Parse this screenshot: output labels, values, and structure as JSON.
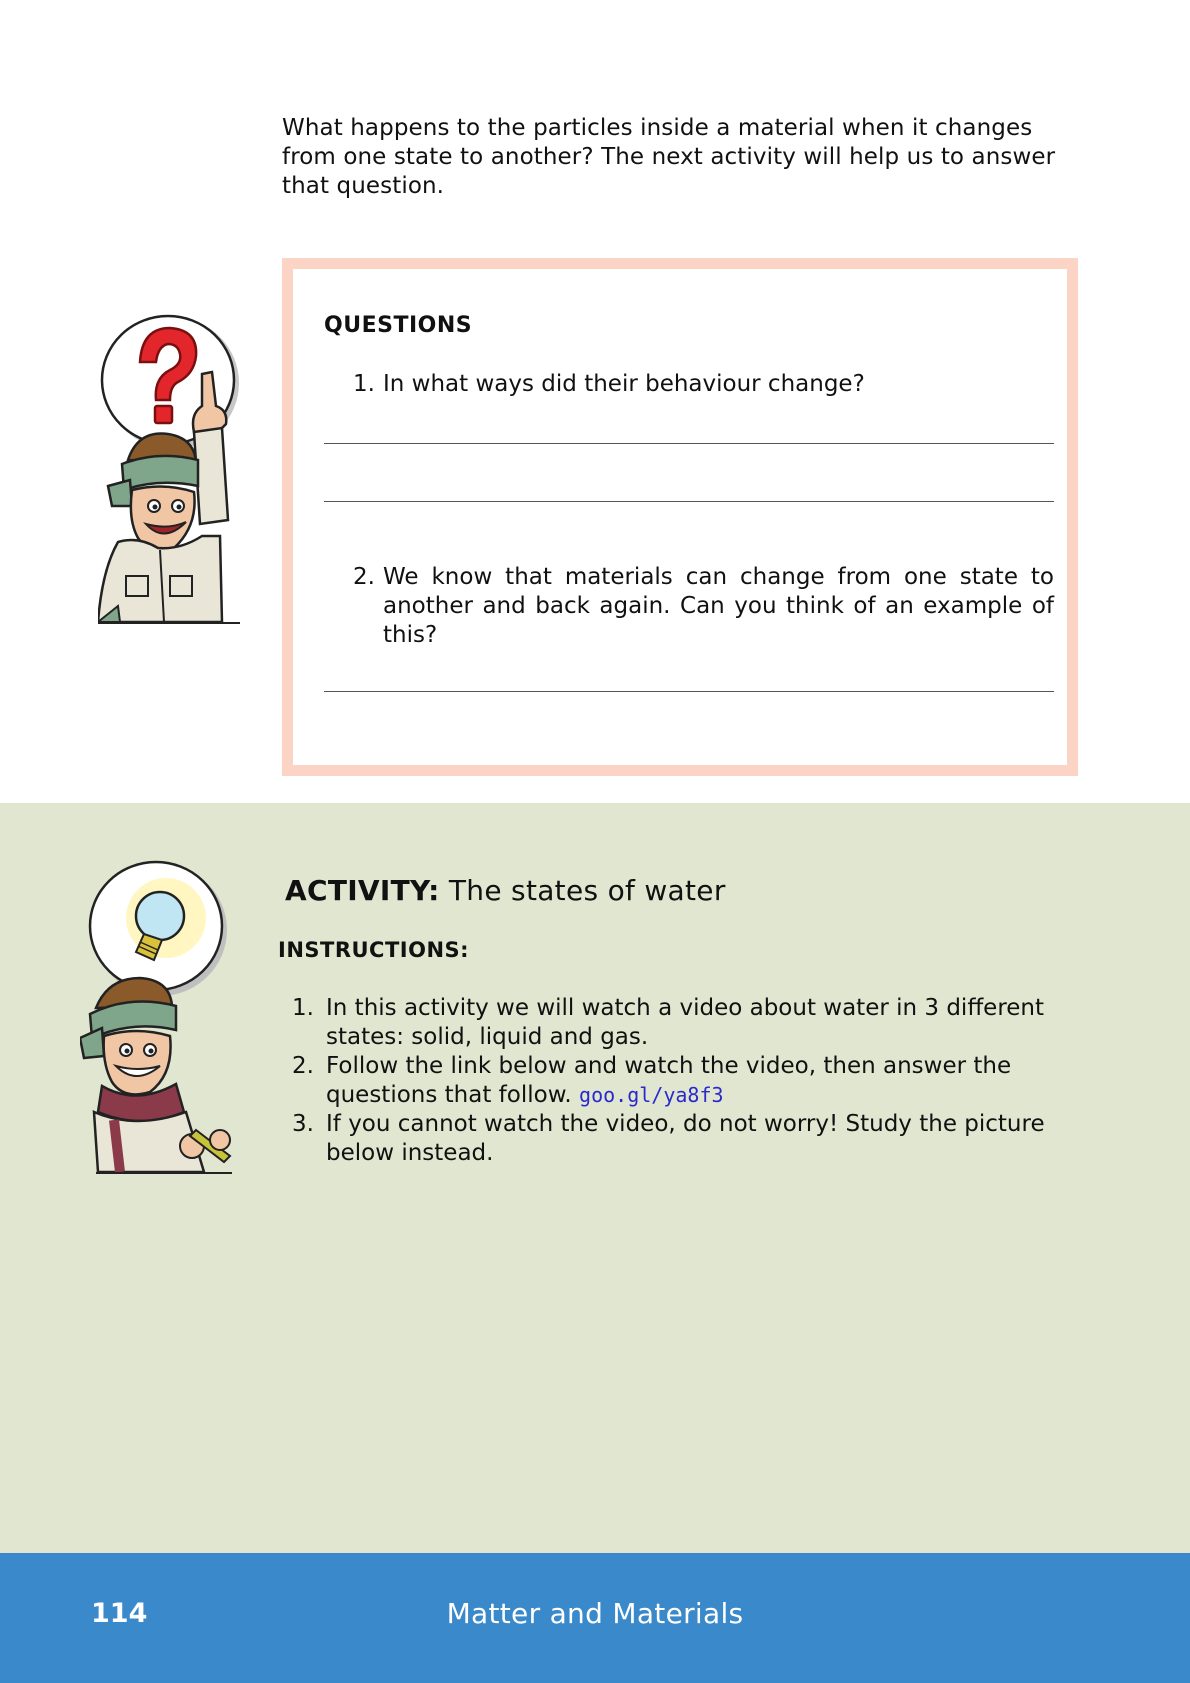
{
  "intro": {
    "text": "What happens to the particles inside a material when it changes from one state to another? The next activity will help us to answer that question."
  },
  "questions": {
    "title": "QUESTIONS",
    "items": [
      {
        "number": "1.",
        "text": "In what ways did their behaviour change?"
      },
      {
        "number": "2.",
        "text": "We know that materials can change from one state to another and back again.  Can you think of an example of this?"
      }
    ]
  },
  "activity": {
    "label": "ACTIVITY:",
    "title": "The states of water",
    "instructions_title": "INSTRUCTIONS:",
    "instructions": [
      {
        "number": "1.",
        "text": "In this activity we will watch a video about water in 3 different states: solid, liquid and gas."
      },
      {
        "number": "2.",
        "text": "Follow the link below and watch the video, then answer the questions that follow.",
        "link": "goo.gl/ya8f3"
      },
      {
        "number": "3.",
        "text": "If you cannot watch the video, do not worry! Study the picture below instead."
      }
    ]
  },
  "footer": {
    "page_number": "114",
    "title": "Matter and Materials"
  },
  "colors": {
    "box_border": "#fbd4c5",
    "activity_bg": "#e1e6d0",
    "footer_bg": "#3a89ca",
    "link": "#2a2acc"
  },
  "icons": {
    "questions_character": "question-mark-character-icon",
    "activity_character": "lightbulb-character-icon"
  }
}
